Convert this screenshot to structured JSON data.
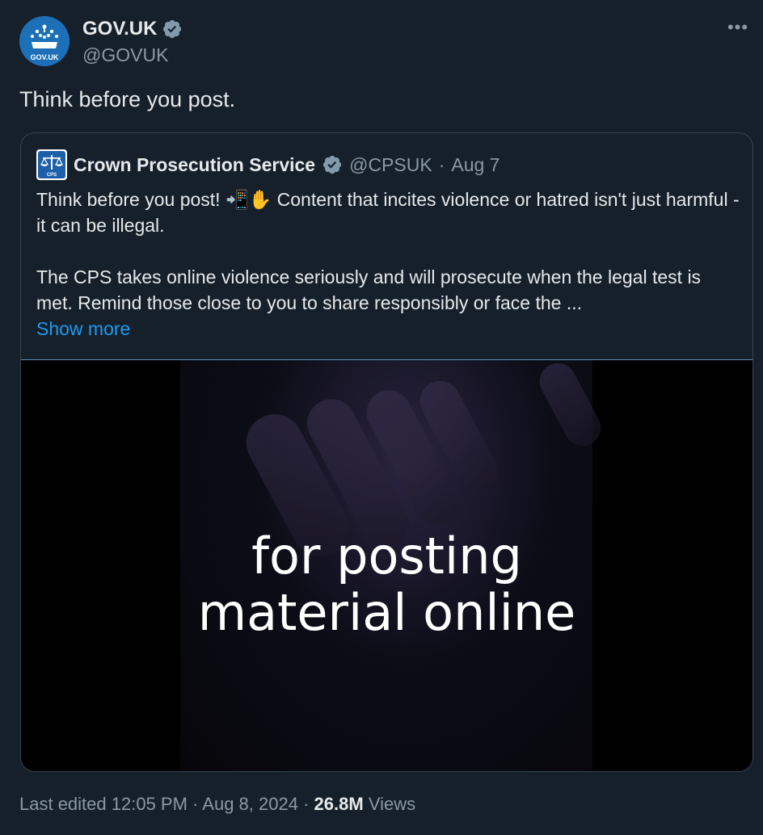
{
  "author": {
    "name": "GOV.UK",
    "handle": "@GOVUK",
    "avatar_text": "GOV.UK",
    "verified_icon": "verified-badge-icon"
  },
  "tweet": {
    "text": "Think before you post."
  },
  "quote": {
    "name": "Crown Prosecution Service",
    "handle": "@CPSUK",
    "separator": "·",
    "date": "Aug 7",
    "avatar_text": "CPS",
    "line1": "Think before you post! 📲✋ Content that incites violence or hatred isn't just harmful - it can be illegal.",
    "line2": "The CPS takes online violence seriously and will prosecute when the legal test is met. Remind those close to you to share responsibly or face the ...",
    "show_more": "Show more",
    "media_caption_line1": "for posting",
    "media_caption_line2": "material online"
  },
  "footer": {
    "edited": "Last edited 12:05 PM",
    "separator": "·",
    "date": "Aug 8, 2024",
    "views_count": "26.8M",
    "views_label": "Views"
  },
  "colors": {
    "background": "#15202b",
    "text": "#e7e9ea",
    "muted": "#8b98a5",
    "link": "#1d9bf0",
    "govuk_blue": "#1d70b8"
  }
}
